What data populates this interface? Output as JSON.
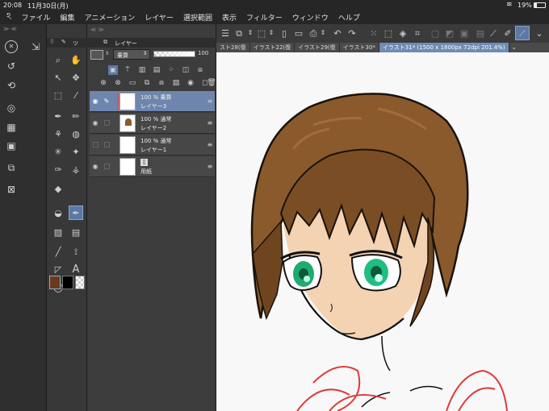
{
  "status": {
    "time": "20:08",
    "date": "11月30日(月)",
    "battery": "19%"
  },
  "menu": [
    "ファイル",
    "編集",
    "アニメーション",
    "レイヤー",
    "選択範囲",
    "表示",
    "フィルター",
    "ウィンドウ",
    "ヘルプ"
  ],
  "tool_palette": {
    "title": "ツ"
  },
  "layer_panel": {
    "title": "レイヤー",
    "blend_mode": "乗算",
    "opacity": "100",
    "layers": [
      {
        "opacity": "100 %",
        "mode": "乗算",
        "name": "レイヤー3"
      },
      {
        "opacity": "100 %",
        "mode": "通常",
        "name": "レイヤー2"
      },
      {
        "opacity": "100 %",
        "mode": "通常",
        "name": "レイヤー1"
      },
      {
        "opacity": "",
        "mode": "",
        "name": "用紙"
      }
    ]
  },
  "tabs": [
    "スト28(復",
    "イラスト22(復",
    "イラスト29(復",
    "イラスト30*",
    "イラスト31* (1500 x 1800px 72dpi 201.4%)"
  ],
  "colors": {
    "main": "#6a3a1c",
    "sub": "#000000",
    "accent": "#6f8bb6"
  }
}
